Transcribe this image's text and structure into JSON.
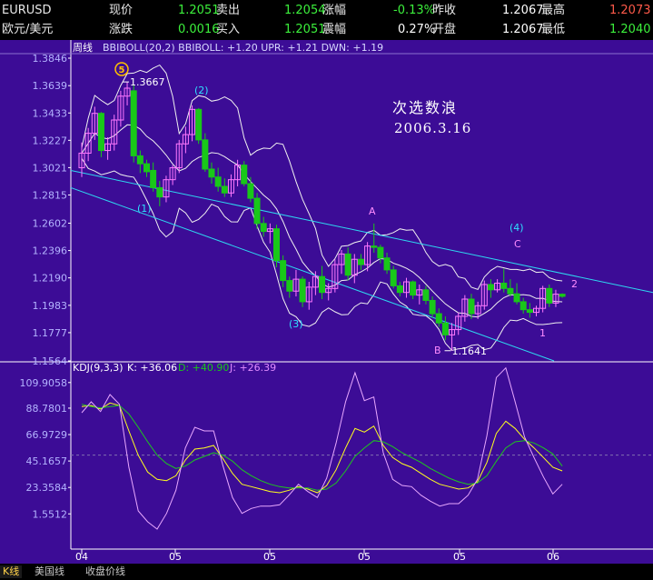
{
  "quote": {
    "symbol": "EURUSD",
    "pair_name": "欧元/美元",
    "price_label": "现价",
    "price": "1.2051",
    "sell_label": "卖出",
    "sell": "1.2054",
    "change_pct_label": "涨幅",
    "change_pct": "-0.13%",
    "prev_close_label": "昨收",
    "prev_close": "1.2067",
    "high_label": "最高",
    "high": "1.2073",
    "change_label": "涨跌",
    "change": "0.0016",
    "buy_label": "买入",
    "buy": "1.2051",
    "amplitude_label": "震幅",
    "amplitude": "0.27%",
    "open_label": "开盘",
    "open": "1.2067",
    "low_label": "最低",
    "low": "1.2040"
  },
  "tabs": [
    "K线",
    "美国线",
    "收盘价线"
  ],
  "colors": {
    "background": "#3c0c96",
    "up": "#ff78ff",
    "down": "#19c819",
    "boll": "#f0f0f0",
    "channel": "#2ed8f0",
    "k_line": "#ffffff",
    "d_line": "#ffff1e",
    "j_line": "#e08cff",
    "wave_label": "#2ee0ff",
    "abc_label": "#ff8cff",
    "text": "#b4b4ff"
  },
  "chart_data": [
    {
      "type": "candlestick",
      "title": "周线",
      "indicator_text": "BBIBOLL(20,2)  BBIBOLL: +1.20  UPR: +1.21  DWN: +1.19",
      "ylim": [
        1.1564,
        1.3846
      ],
      "yticks": [
        "1.3846",
        "1.3639",
        "1.3433",
        "1.3227",
        "1.3021",
        "1.2815",
        "1.2602",
        "1.2396",
        "1.2190",
        "1.1983",
        "1.1777",
        "1.1564"
      ],
      "xticks": [
        "04",
        "05",
        "05",
        "05",
        "05",
        "05",
        "06"
      ],
      "annotation": [
        "次选数浪",
        "2006.3.16"
      ],
      "high_marker": "1.3667",
      "low_marker": "1.1641",
      "wave_labels": [
        "5",
        "(1)",
        "(2)",
        "(3)",
        "(4)",
        "1",
        "2",
        "A",
        "B",
        "C"
      ],
      "candles": [
        {
          "o": 1.302,
          "h": 1.321,
          "l": 1.295,
          "c": 1.313
        },
        {
          "o": 1.313,
          "h": 1.332,
          "l": 1.307,
          "c": 1.328
        },
        {
          "o": 1.328,
          "h": 1.348,
          "l": 1.323,
          "c": 1.343
        },
        {
          "o": 1.343,
          "h": 1.344,
          "l": 1.31,
          "c": 1.315
        },
        {
          "o": 1.315,
          "h": 1.325,
          "l": 1.308,
          "c": 1.32
        },
        {
          "o": 1.32,
          "h": 1.342,
          "l": 1.315,
          "c": 1.338
        },
        {
          "o": 1.338,
          "h": 1.36,
          "l": 1.333,
          "c": 1.356
        },
        {
          "o": 1.356,
          "h": 1.3667,
          "l": 1.349,
          "c": 1.362
        },
        {
          "o": 1.36,
          "h": 1.364,
          "l": 1.306,
          "c": 1.311
        },
        {
          "o": 1.311,
          "h": 1.315,
          "l": 1.298,
          "c": 1.305
        },
        {
          "o": 1.305,
          "h": 1.308,
          "l": 1.295,
          "c": 1.299
        },
        {
          "o": 1.3,
          "h": 1.306,
          "l": 1.284,
          "c": 1.287
        },
        {
          "o": 1.287,
          "h": 1.292,
          "l": 1.273,
          "c": 1.28
        },
        {
          "o": 1.28,
          "h": 1.296,
          "l": 1.276,
          "c": 1.293
        },
        {
          "o": 1.293,
          "h": 1.304,
          "l": 1.289,
          "c": 1.302
        },
        {
          "o": 1.302,
          "h": 1.323,
          "l": 1.298,
          "c": 1.32
        },
        {
          "o": 1.32,
          "h": 1.333,
          "l": 1.313,
          "c": 1.327
        },
        {
          "o": 1.327,
          "h": 1.349,
          "l": 1.322,
          "c": 1.346
        },
        {
          "o": 1.346,
          "h": 1.347,
          "l": 1.32,
          "c": 1.323
        },
        {
          "o": 1.323,
          "h": 1.328,
          "l": 1.299,
          "c": 1.301
        },
        {
          "o": 1.301,
          "h": 1.306,
          "l": 1.29,
          "c": 1.295
        },
        {
          "o": 1.295,
          "h": 1.302,
          "l": 1.284,
          "c": 1.288
        },
        {
          "o": 1.288,
          "h": 1.294,
          "l": 1.28,
          "c": 1.283
        },
        {
          "o": 1.283,
          "h": 1.297,
          "l": 1.28,
          "c": 1.293
        },
        {
          "o": 1.293,
          "h": 1.308,
          "l": 1.288,
          "c": 1.304
        },
        {
          "o": 1.304,
          "h": 1.307,
          "l": 1.288,
          "c": 1.29
        },
        {
          "o": 1.29,
          "h": 1.295,
          "l": 1.276,
          "c": 1.279
        },
        {
          "o": 1.279,
          "h": 1.283,
          "l": 1.256,
          "c": 1.26
        },
        {
          "o": 1.26,
          "h": 1.265,
          "l": 1.25,
          "c": 1.254
        },
        {
          "o": 1.254,
          "h": 1.26,
          "l": 1.245,
          "c": 1.256
        },
        {
          "o": 1.256,
          "h": 1.259,
          "l": 1.227,
          "c": 1.232
        },
        {
          "o": 1.232,
          "h": 1.236,
          "l": 1.212,
          "c": 1.217
        },
        {
          "o": 1.217,
          "h": 1.22,
          "l": 1.204,
          "c": 1.209
        },
        {
          "o": 1.209,
          "h": 1.225,
          "l": 1.205,
          "c": 1.218
        },
        {
          "o": 1.218,
          "h": 1.22,
          "l": 1.197,
          "c": 1.201
        },
        {
          "o": 1.201,
          "h": 1.216,
          "l": 1.195,
          "c": 1.212
        },
        {
          "o": 1.212,
          "h": 1.224,
          "l": 1.206,
          "c": 1.22
        },
        {
          "o": 1.22,
          "h": 1.228,
          "l": 1.203,
          "c": 1.208
        },
        {
          "o": 1.208,
          "h": 1.215,
          "l": 1.202,
          "c": 1.211
        },
        {
          "o": 1.211,
          "h": 1.233,
          "l": 1.208,
          "c": 1.229
        },
        {
          "o": 1.229,
          "h": 1.24,
          "l": 1.222,
          "c": 1.237
        },
        {
          "o": 1.237,
          "h": 1.242,
          "l": 1.217,
          "c": 1.221
        },
        {
          "o": 1.221,
          "h": 1.237,
          "l": 1.215,
          "c": 1.233
        },
        {
          "o": 1.233,
          "h": 1.237,
          "l": 1.225,
          "c": 1.229
        },
        {
          "o": 1.229,
          "h": 1.246,
          "l": 1.224,
          "c": 1.243
        },
        {
          "o": 1.243,
          "h": 1.26,
          "l": 1.238,
          "c": 1.242
        },
        {
          "o": 1.242,
          "h": 1.244,
          "l": 1.23,
          "c": 1.234
        },
        {
          "o": 1.234,
          "h": 1.238,
          "l": 1.222,
          "c": 1.225
        },
        {
          "o": 1.225,
          "h": 1.228,
          "l": 1.211,
          "c": 1.213
        },
        {
          "o": 1.213,
          "h": 1.216,
          "l": 1.205,
          "c": 1.208
        },
        {
          "o": 1.208,
          "h": 1.219,
          "l": 1.204,
          "c": 1.216
        },
        {
          "o": 1.216,
          "h": 1.217,
          "l": 1.203,
          "c": 1.206
        },
        {
          "o": 1.206,
          "h": 1.214,
          "l": 1.199,
          "c": 1.21
        },
        {
          "o": 1.21,
          "h": 1.213,
          "l": 1.199,
          "c": 1.202
        },
        {
          "o": 1.202,
          "h": 1.205,
          "l": 1.189,
          "c": 1.192
        },
        {
          "o": 1.192,
          "h": 1.196,
          "l": 1.182,
          "c": 1.185
        },
        {
          "o": 1.185,
          "h": 1.19,
          "l": 1.172,
          "c": 1.176
        },
        {
          "o": 1.176,
          "h": 1.185,
          "l": 1.1641,
          "c": 1.18
        },
        {
          "o": 1.18,
          "h": 1.193,
          "l": 1.176,
          "c": 1.19
        },
        {
          "o": 1.19,
          "h": 1.206,
          "l": 1.186,
          "c": 1.203
        },
        {
          "o": 1.203,
          "h": 1.207,
          "l": 1.188,
          "c": 1.192
        },
        {
          "o": 1.192,
          "h": 1.201,
          "l": 1.188,
          "c": 1.198
        },
        {
          "o": 1.198,
          "h": 1.217,
          "l": 1.195,
          "c": 1.214
        },
        {
          "o": 1.214,
          "h": 1.218,
          "l": 1.204,
          "c": 1.21
        },
        {
          "o": 1.21,
          "h": 1.218,
          "l": 1.208,
          "c": 1.215
        },
        {
          "o": 1.215,
          "h": 1.226,
          "l": 1.208,
          "c": 1.211
        },
        {
          "o": 1.211,
          "h": 1.218,
          "l": 1.205,
          "c": 1.207
        },
        {
          "o": 1.207,
          "h": 1.215,
          "l": 1.199,
          "c": 1.201
        },
        {
          "o": 1.201,
          "h": 1.204,
          "l": 1.192,
          "c": 1.195
        },
        {
          "o": 1.195,
          "h": 1.2,
          "l": 1.189,
          "c": 1.193
        },
        {
          "o": 1.193,
          "h": 1.198,
          "l": 1.19,
          "c": 1.196
        },
        {
          "o": 1.196,
          "h": 1.213,
          "l": 1.193,
          "c": 1.211
        },
        {
          "o": 1.211,
          "h": 1.214,
          "l": 1.197,
          "c": 1.2
        },
        {
          "o": 1.2,
          "h": 1.21,
          "l": 1.197,
          "c": 1.2067
        },
        {
          "o": 1.2067,
          "h": 1.2073,
          "l": 1.204,
          "c": 1.2051
        }
      ]
    },
    {
      "type": "line",
      "title": "KDJ(9,3,3)",
      "values_text": {
        "K": "+36.06",
        "D": "+40.90",
        "J": "+26.39"
      },
      "ylim": [
        -5,
        115
      ],
      "yticks": [
        "109.9058",
        "88.7801",
        "66.9729",
        "45.1657",
        "23.3584",
        "1.5512"
      ],
      "reference_line": 50,
      "series": [
        {
          "name": "K",
          "values": [
            90,
            91,
            88,
            93,
            91,
            70,
            50,
            36,
            30,
            29,
            33,
            46,
            55,
            56,
            58,
            47,
            35,
            26,
            24,
            22,
            20,
            19,
            21,
            24,
            22,
            19,
            25,
            38,
            56,
            72,
            69,
            74,
            58,
            48,
            43,
            40,
            35,
            30,
            26,
            24,
            22,
            23,
            28,
            44,
            68,
            78,
            72,
            63,
            56,
            48,
            40,
            37
          ]
        },
        {
          "name": "D",
          "values": [
            92,
            90,
            89,
            90,
            91,
            84,
            73,
            61,
            50,
            43,
            39,
            41,
            46,
            49,
            52,
            50,
            45,
            38,
            33,
            29,
            26,
            24,
            23,
            23,
            23,
            21,
            22,
            27,
            37,
            49,
            56,
            62,
            61,
            57,
            52,
            48,
            44,
            39,
            35,
            31,
            28,
            26,
            27,
            33,
            45,
            56,
            61,
            62,
            60,
            56,
            51,
            41
          ]
        },
        {
          "name": "J",
          "values": [
            85,
            94,
            86,
            100,
            92,
            40,
            4,
            -5,
            -11,
            2,
            21,
            56,
            73,
            70,
            70,
            41,
            15,
            2,
            6,
            8,
            8,
            9,
            17,
            26,
            20,
            15,
            31,
            60,
            94,
            118,
            95,
            98,
            52,
            30,
            25,
            24,
            17,
            12,
            8,
            10,
            10,
            17,
            30,
            66,
            114,
            122,
            94,
            65,
            48,
            32,
            18,
            26
          ]
        }
      ]
    }
  ]
}
